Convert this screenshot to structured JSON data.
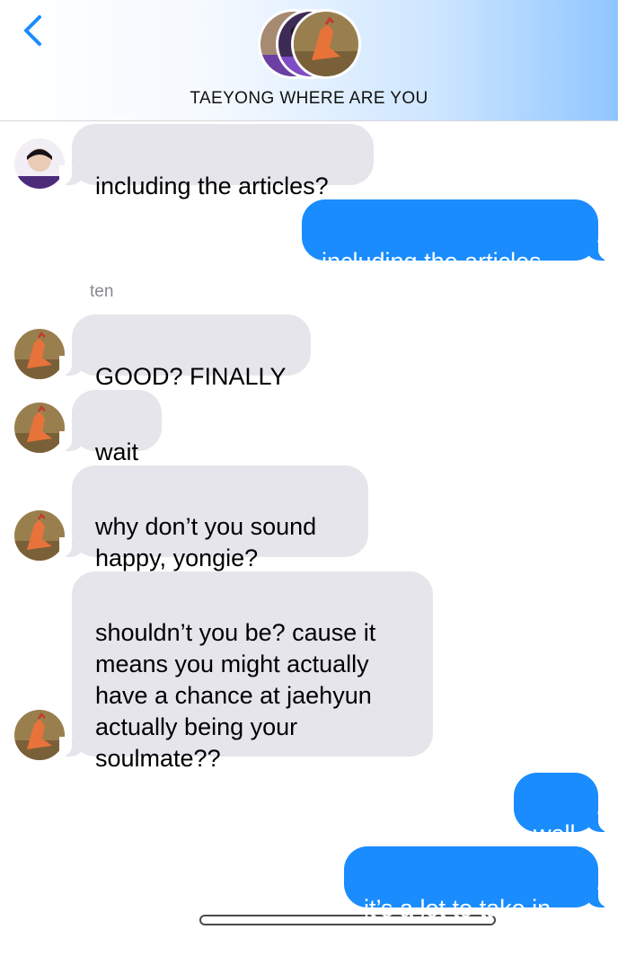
{
  "header": {
    "title": "TAEYONG WHERE ARE YOU",
    "back_icon": "chevron-left-icon",
    "accent": "#1a8cfd",
    "gradient_end": "#8fc6ff"
  },
  "conversation": {
    "sender_label": "ten",
    "messages": [
      {
        "direction": "incoming",
        "avatar": "person-avatar",
        "text": "including the articles?"
      },
      {
        "direction": "outgoing",
        "text": "including the articles."
      },
      {
        "direction": "incoming",
        "avatar": "hand-avatar",
        "text": "GOOD? FINALLY"
      },
      {
        "direction": "incoming",
        "avatar": "hand-avatar",
        "text": "wait"
      },
      {
        "direction": "incoming",
        "avatar": "hand-avatar",
        "text": "why don’t you sound\nhappy, yongie?"
      },
      {
        "direction": "incoming",
        "avatar": "hand-avatar",
        "text": "shouldn’t you be? cause it\nmeans you might actually\nhave a chance at jaehyun\nactually being your\nsoulmate??"
      },
      {
        "direction": "outgoing",
        "text": "well"
      },
      {
        "direction": "outgoing",
        "text": "it’s a lot to take in."
      }
    ]
  },
  "colors": {
    "incoming_bubble": "#e6e5eb",
    "outgoing_bubble": "#1a8cfd",
    "sender_label": "#8a8a8f"
  }
}
